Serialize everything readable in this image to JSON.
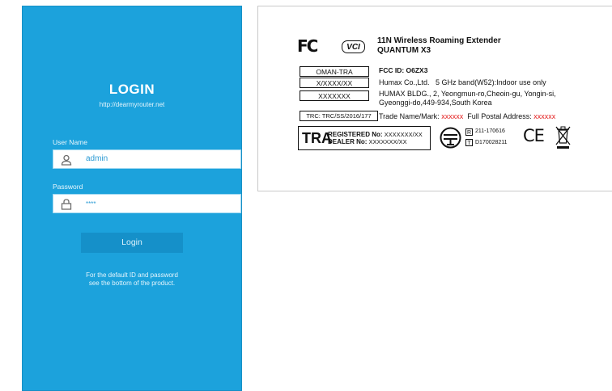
{
  "login": {
    "title": "LOGIN",
    "url": "http://dearmyrouter.net",
    "username_label": "User Name",
    "username_value": "admin",
    "password_label": "Password",
    "password_value": "****",
    "button_label": "Login",
    "note_line1": "For the default ID and password",
    "note_line2": "see the bottom of the product."
  },
  "label": {
    "fc_logo": "FC",
    "vci_logo": "VCI",
    "product_line1": "11N Wireless Roaming Extender",
    "product_line2": "QUANTUM X3",
    "oman": "OMAN-TRA",
    "oman_code1": "X/XXXX/XX",
    "oman_code2": "XXXXXXX",
    "trc": "TRC: TRC/SS/2016/177",
    "fcc_id": "FCC ID: O6ZX3",
    "company": "Humax Co.,Ltd.",
    "band_note": "5 GHz band(W52):Indoor use only",
    "address1": "HUMAX BLDG., 2, Yeongmun-ro,Cheoin-gu, Yongin-si,",
    "address2": "Gyeonggi-do,449-934,South Korea",
    "trade_label": "Trade Name/Mark:",
    "trade_value": "xxxxxx",
    "postal_label": "Full Postal Address:",
    "postal_value": "xxxxxx",
    "tra_word": "TRA",
    "registered_label": "REGISTERED No:",
    "registered_value": "XXXXXXX/XX",
    "dealer_label": "DEALER No:",
    "dealer_value": "XXXXXXX/XX",
    "r_mark": "R",
    "t_mark": "T",
    "r_number": "211-170616",
    "t_number": "D170028211",
    "ce_mark": "CE",
    "accent_red": "#e41e1e"
  },
  "colors": {
    "panel_blue": "#1ca2dc",
    "button_blue": "#1590c9"
  },
  "icons": [
    "user-icon",
    "lock-icon",
    "telecom-mark-icon",
    "weee-bin-icon"
  ]
}
